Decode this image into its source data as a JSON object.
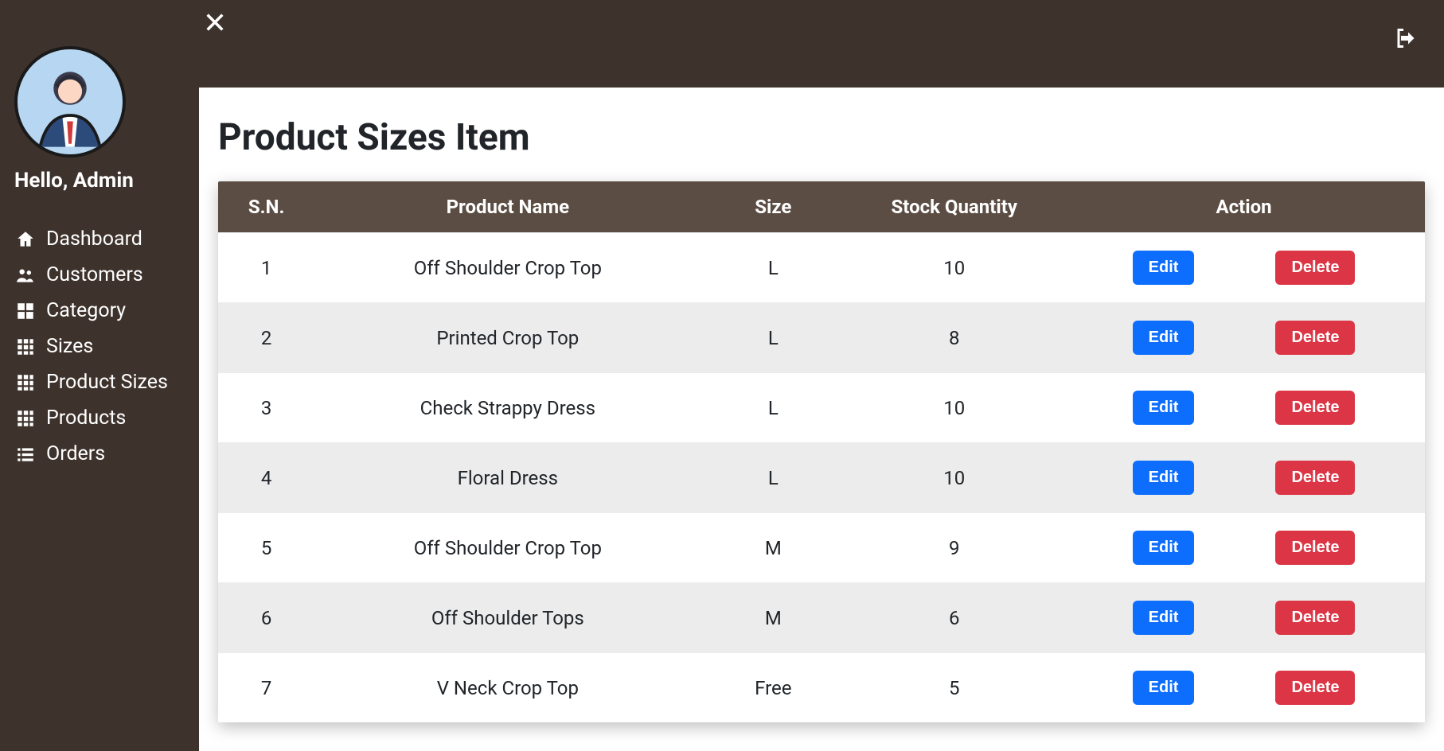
{
  "sidebar": {
    "greeting": "Hello, Admin",
    "items": [
      {
        "label": "Dashboard",
        "icon": "home-icon"
      },
      {
        "label": "Customers",
        "icon": "users-icon"
      },
      {
        "label": "Category",
        "icon": "grid-large-icon"
      },
      {
        "label": "Sizes",
        "icon": "grid-icon"
      },
      {
        "label": "Product Sizes",
        "icon": "grid-icon"
      },
      {
        "label": "Products",
        "icon": "grid-icon"
      },
      {
        "label": "Orders",
        "icon": "list-icon"
      }
    ]
  },
  "page": {
    "title": "Product Sizes Item"
  },
  "table": {
    "headers": {
      "sn": "S.N.",
      "product_name": "Product Name",
      "size": "Size",
      "stock_qty": "Stock Quantity",
      "action": "Action"
    },
    "action_labels": {
      "edit": "Edit",
      "delete": "Delete"
    },
    "rows": [
      {
        "sn": "1",
        "product_name": "Off Shoulder Crop Top",
        "size": "L",
        "stock_qty": "10"
      },
      {
        "sn": "2",
        "product_name": "Printed Crop Top",
        "size": "L",
        "stock_qty": "8"
      },
      {
        "sn": "3",
        "product_name": "Check Strappy Dress",
        "size": "L",
        "stock_qty": "10"
      },
      {
        "sn": "4",
        "product_name": "Floral Dress",
        "size": "L",
        "stock_qty": "10"
      },
      {
        "sn": "5",
        "product_name": "Off Shoulder Crop Top",
        "size": "M",
        "stock_qty": "9"
      },
      {
        "sn": "6",
        "product_name": "Off Shoulder Tops",
        "size": "M",
        "stock_qty": "6"
      },
      {
        "sn": "7",
        "product_name": "V Neck Crop Top",
        "size": "Free",
        "stock_qty": "5"
      }
    ]
  }
}
